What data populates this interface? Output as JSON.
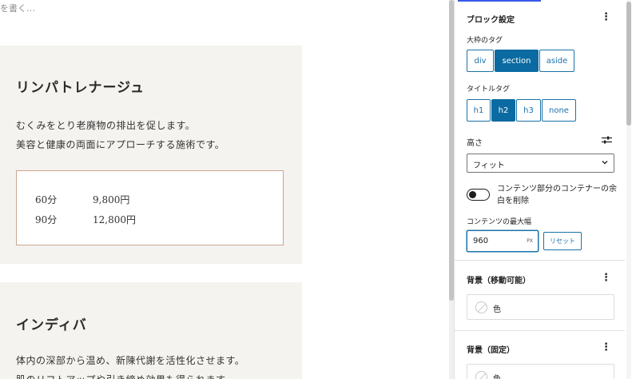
{
  "canvas": {
    "top_hint": "を書く…",
    "cards": [
      {
        "title": "リンパトレナージュ",
        "lines": [
          "むくみをとり老廃物の排出を促します。",
          "美容と健康の両面にアプローチする施術です。"
        ],
        "prices": [
          {
            "duration": "60分",
            "price": "9,800円"
          },
          {
            "duration": "90分",
            "price": "12,800円"
          }
        ]
      },
      {
        "title": "インディバ",
        "lines": [
          "体内の深部から温め、新陳代謝を活性化させます。",
          "肌のリフトアップや引き締め効果も得られます。"
        ]
      }
    ]
  },
  "sidebar": {
    "block_settings": {
      "title": "ブロック設定",
      "outer_tag_label": "大枠のタグ",
      "outer_tags": [
        "div",
        "section",
        "aside"
      ],
      "outer_tag_selected": "section",
      "title_tag_label": "タイトルタグ",
      "title_tags": [
        "h1",
        "h2",
        "h3",
        "none"
      ],
      "title_tag_selected": "h2",
      "height_label": "高さ",
      "height_value": "フィット",
      "toggle_label": "コンテンツ部分のコンテナーの余白を削除",
      "toggle_on": false,
      "max_width_label": "コンテンツの最大幅",
      "max_width_value": "960",
      "max_width_unit": "PX",
      "reset_label": "リセット"
    },
    "bg_movable": {
      "title": "背景（移動可能）",
      "color_label": "色"
    },
    "bg_fixed": {
      "title": "背景（固定）",
      "color_label": "色"
    }
  }
}
